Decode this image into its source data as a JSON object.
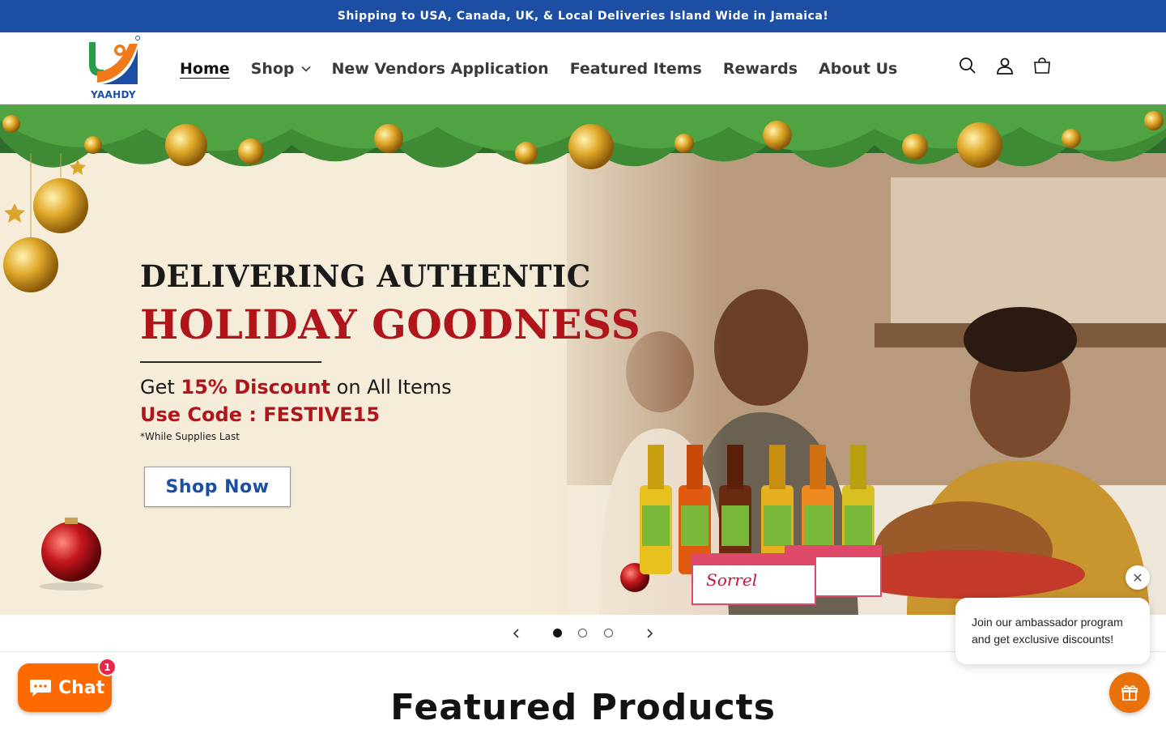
{
  "announcement": {
    "text": "Shipping to USA, Canada, UK, & Local Deliveries Island Wide in Jamaica!"
  },
  "header": {
    "logo_text": "YAAHDY",
    "nav": [
      {
        "label": "Home",
        "active": true
      },
      {
        "label": "Shop",
        "has_dropdown": true
      },
      {
        "label": "New Vendors Application"
      },
      {
        "label": "Featured Items"
      },
      {
        "label": "Rewards"
      },
      {
        "label": "About Us"
      }
    ],
    "icons": [
      "search-icon",
      "account-icon",
      "cart-icon"
    ]
  },
  "hero": {
    "line1": "DELIVERING AUTHENTIC",
    "line2": "HOLIDAY GOODNESS",
    "promo_prefix": "Get ",
    "promo_highlight": "15% Discount",
    "promo_suffix": " on All Items",
    "code_line": "Use Code : FESTIVE15",
    "note": "*While Supplies Last",
    "cta": "Shop Now",
    "product_label": "Sorrel"
  },
  "slider": {
    "slide_count": 3,
    "active_index": 0
  },
  "featured": {
    "title": "Featured Products"
  },
  "chat": {
    "label": "Chat",
    "badge": "1"
  },
  "ambassador": {
    "text": "Join our ambassador program and get exclusive discounts!",
    "close": "✕"
  },
  "colors": {
    "brand_blue": "#1c4fa3",
    "accent_red": "#b0151c",
    "chat_orange": "#ff6a00",
    "gift_orange": "#e8710a"
  }
}
